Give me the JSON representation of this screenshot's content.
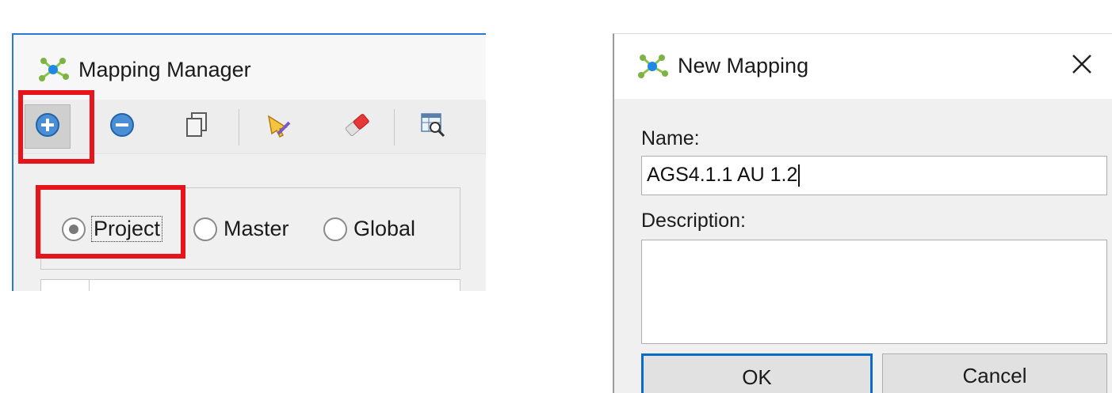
{
  "mapping_manager": {
    "title": "Mapping Manager",
    "toolbar": {
      "add": "plus-circle-icon",
      "remove": "minus-circle-icon",
      "copy": "copy-icon",
      "edit": "pencil-icon",
      "clear": "eraser-icon",
      "view": "search-table-icon"
    },
    "scope_options": [
      {
        "label": "Project",
        "selected": true
      },
      {
        "label": "Master",
        "selected": false
      },
      {
        "label": "Global",
        "selected": false
      }
    ]
  },
  "new_mapping_dialog": {
    "title": "New Mapping",
    "name_label": "Name:",
    "name_value": "AGS4.1.1 AU 1.2",
    "description_label": "Description:",
    "description_value": "",
    "ok_label": "OK",
    "cancel_label": "Cancel"
  },
  "colors": {
    "highlight": "#e8141b",
    "window_border": "#2b79d6",
    "default_button_border": "#0a6bc8"
  }
}
